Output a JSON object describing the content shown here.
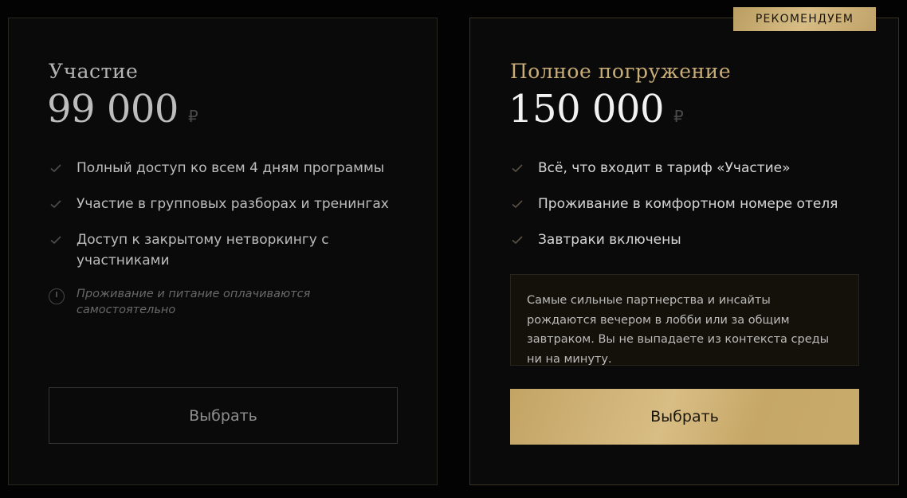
{
  "plans": {
    "basic": {
      "name": "Участие",
      "price": "99 000",
      "currency": "₽",
      "features": [
        "Полный доступ ко всем 4 дням программы",
        "Участие в групповых разборах и тренингах",
        "Доступ к закрытому нетворкингу с участниками"
      ],
      "note": "Проживание и питание оплачиваются самостоятельно",
      "button_label": "Выбрать"
    },
    "premium": {
      "badge": "РЕКОМЕНДУЕМ",
      "name": "Полное погружение",
      "price": "150 000",
      "currency": "₽",
      "features": [
        "Всё, что входит в тариф «Участие»",
        "Проживание в комфортном номере отеля",
        "Завтраки включены"
      ],
      "quote": "Самые сильные партнерства и инсайты рождаются вечером в лобби или за общим завтраком. Вы не выпадаете из контекста среды ни на минуту.",
      "button_label": "Выбрать"
    }
  },
  "icons": {
    "feature": "check-icon",
    "note": "clock-icon"
  },
  "colors": {
    "background": "#030303",
    "card": "#0a0a0a",
    "gold": "#c8ad77",
    "gold_button": "#d2b67c"
  }
}
